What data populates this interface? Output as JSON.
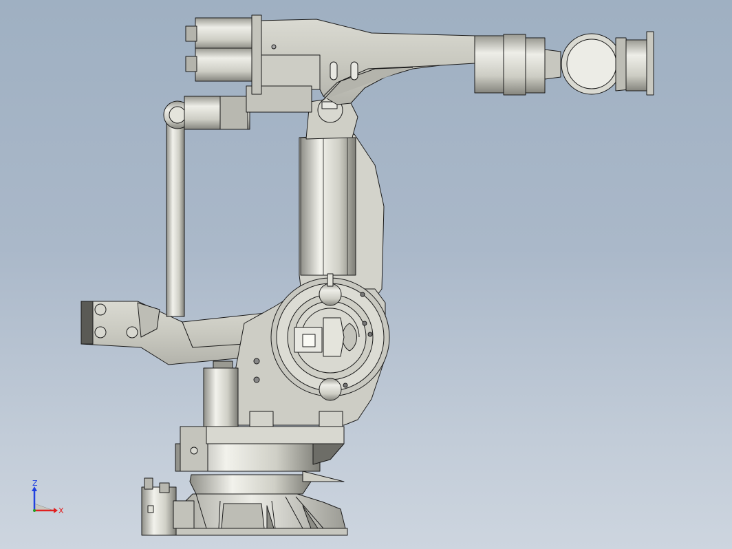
{
  "viewport": {
    "background_top": "#9fb0c2",
    "background_bottom": "#cdd5df",
    "model": "industrial-robot-arm",
    "view": "side"
  },
  "colors": {
    "metal": "#cfcfc6",
    "metal_light": "#e6e6df",
    "metal_dark": "#a9a9a1",
    "edge": "#1a1a1a",
    "axis_x": "#e02020",
    "axis_y": "#20a020",
    "axis_z": "#2040e0"
  },
  "triad": {
    "z_label": "Z",
    "x_label": "X"
  }
}
